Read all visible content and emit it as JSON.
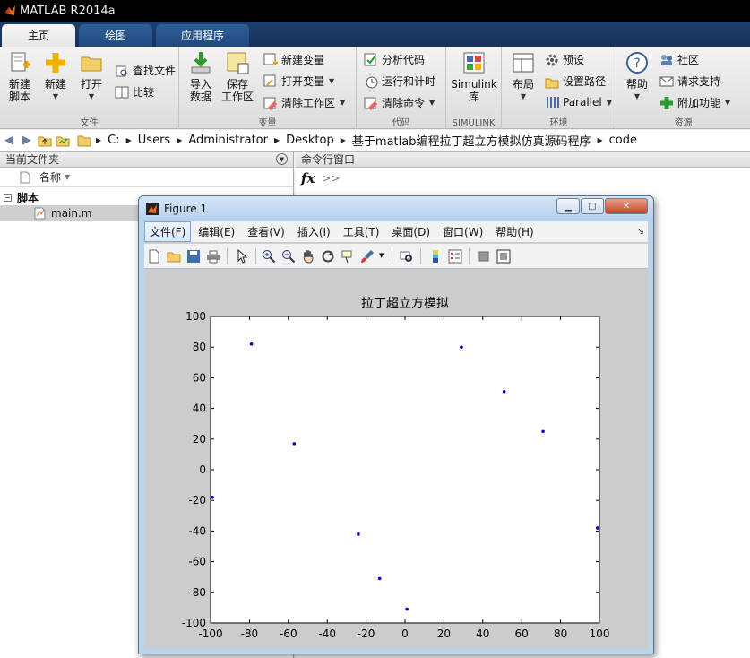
{
  "app": {
    "title": "MATLAB R2014a"
  },
  "tabs": [
    {
      "label": "主页",
      "active": true
    },
    {
      "label": "绘图",
      "active": false
    },
    {
      "label": "应用程序",
      "active": false
    }
  ],
  "ribbon": {
    "file": {
      "label": "文件",
      "new_script": "新建\n脚本",
      "new": "新建",
      "open": "打开",
      "find_files": "查找文件",
      "compare": "比较"
    },
    "variable": {
      "label": "变量",
      "import": "导入\n数据",
      "save_ws": "保存\n工作区",
      "new_var": "新建变量",
      "open_var": "打开变量",
      "clear_ws": "清除工作区"
    },
    "code": {
      "label": "代码",
      "analyze": "分析代码",
      "run_time": "运行和计时",
      "clear_cmd": "清除命令"
    },
    "simulink": {
      "label": "SIMULINK",
      "lib": "Simulink\n库"
    },
    "env": {
      "label": "环境",
      "layout": "布局",
      "prefs": "预设",
      "set_path": "设置路径",
      "parallel": "Parallel"
    },
    "resources": {
      "label": "资源",
      "help": "帮助",
      "community": "社区",
      "support": "请求支持",
      "addons": "附加功能"
    }
  },
  "address": {
    "crumbs": [
      "C:",
      "Users",
      "Administrator",
      "Desktop",
      "基于matlab编程拉丁超立方模拟仿真源码程序",
      "code"
    ]
  },
  "current_folder": {
    "title": "当前文件夹",
    "col_name": "名称",
    "group": "脚本",
    "file": "main.m"
  },
  "command_window": {
    "title": "命令行窗口",
    "fx": "fx",
    "prompt": ">>"
  },
  "figure": {
    "title": "Figure 1",
    "menu": [
      "文件(F)",
      "编辑(E)",
      "查看(V)",
      "插入(I)",
      "工具(T)",
      "桌面(D)",
      "窗口(W)",
      "帮助(H)"
    ]
  },
  "chart_data": {
    "type": "scatter",
    "title": "拉丁超立方模拟",
    "xlabel": "",
    "ylabel": "",
    "xlim": [
      -100,
      100
    ],
    "ylim": [
      -100,
      100
    ],
    "xticks": [
      -100,
      -80,
      -60,
      -40,
      -20,
      0,
      20,
      40,
      60,
      80,
      100
    ],
    "yticks": [
      -100,
      -80,
      -60,
      -40,
      -20,
      0,
      20,
      40,
      60,
      80,
      100
    ],
    "grid": false,
    "marker_color": "#0000cc",
    "points": [
      [
        -99,
        -18
      ],
      [
        -79,
        82
      ],
      [
        -57,
        17
      ],
      [
        -24,
        -42
      ],
      [
        -13,
        -71
      ],
      [
        1,
        -91
      ],
      [
        29,
        80
      ],
      [
        51,
        51
      ],
      [
        71,
        25
      ],
      [
        99,
        -38
      ]
    ]
  }
}
